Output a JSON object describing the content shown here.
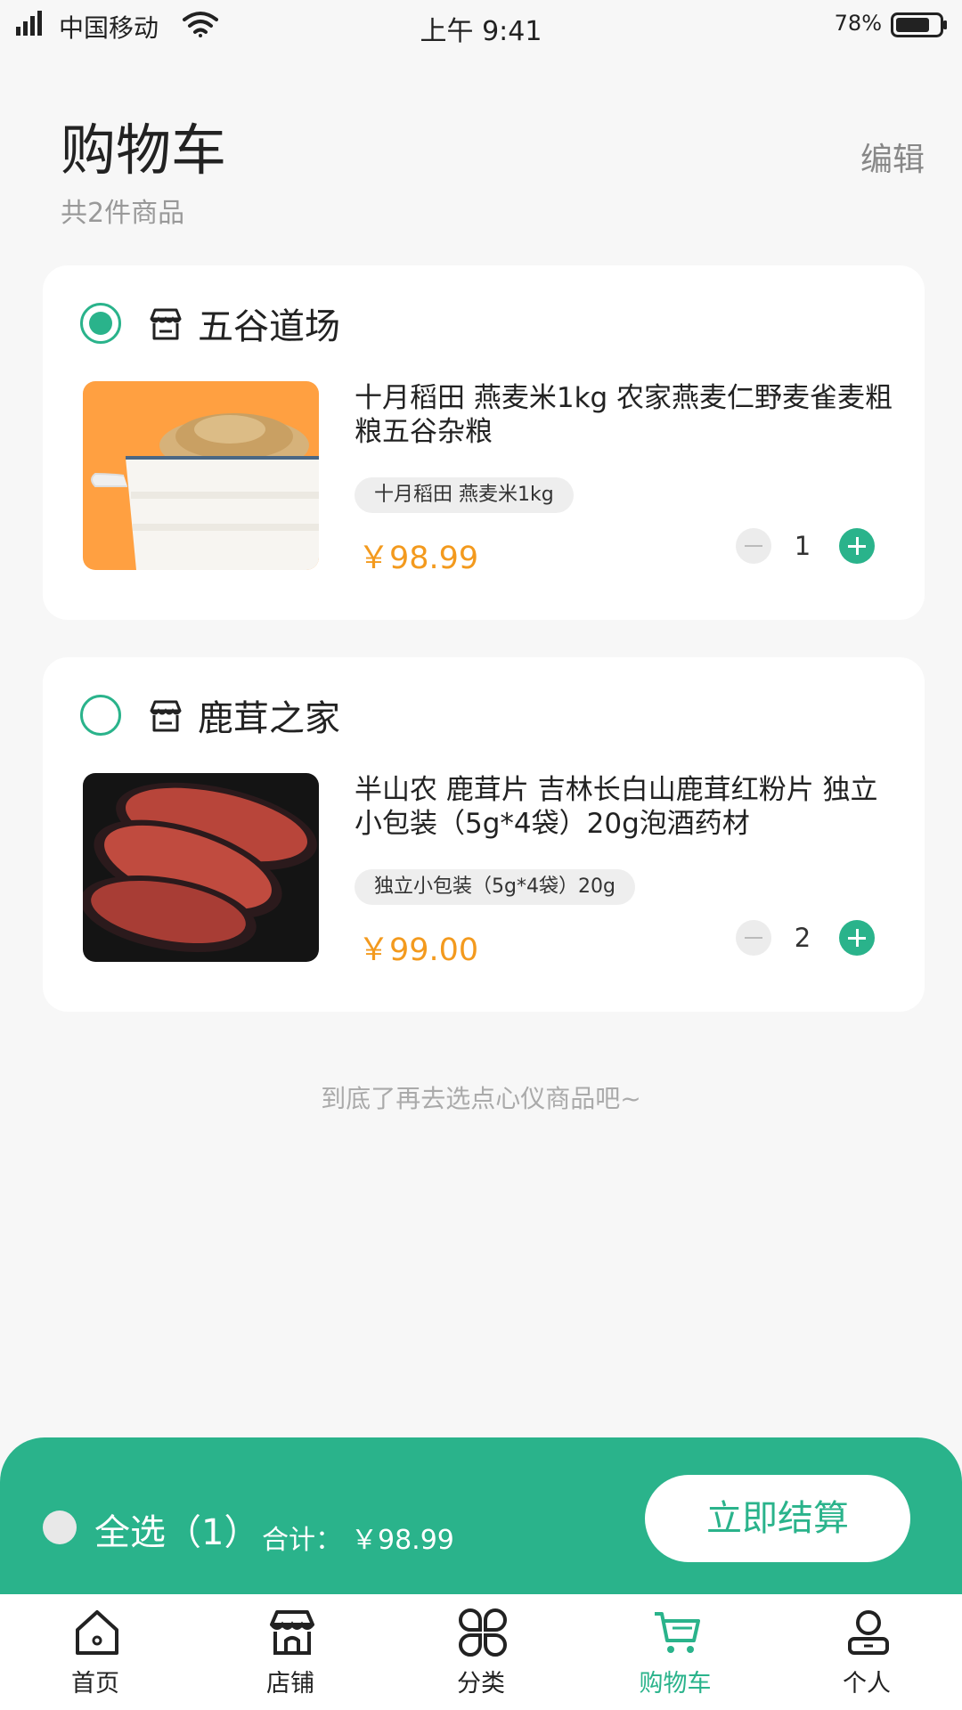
{
  "status_bar": {
    "carrier": "中国移动",
    "time": "上午 9:41",
    "battery": "78%",
    "battery_level": 0.78
  },
  "header": {
    "title": "购物车",
    "edit_label": "编辑",
    "item_count": "共2件商品"
  },
  "stores": [
    {
      "name": "五谷道场",
      "selected": true,
      "product": {
        "title": "十月稻田 燕麦米1kg 农家燕麦仁野麦雀麦粗粮五谷杂粮",
        "spec": "十月稻田 燕麦米1kg",
        "price": "￥98.99",
        "quantity": "1"
      }
    },
    {
      "name": "鹿茸之家",
      "selected": false,
      "product": {
        "title": "半山农 鹿茸片 吉林长白山鹿茸红粉片 独立小包装（5g*4袋）20g泡酒药材",
        "spec": "独立小包装（5g*4袋）20g",
        "price": "￥99.00",
        "quantity": "2"
      }
    }
  ],
  "end_note": "到底了再去选点心仪商品吧~",
  "checkout": {
    "select_all_label": "全选（1）",
    "total_label": "合计：",
    "total_amount": "￥98.99",
    "button_label": "立即结算"
  },
  "tabs": [
    {
      "label": "首页",
      "icon": "home-icon",
      "active": false
    },
    {
      "label": "店铺",
      "icon": "store-icon",
      "active": false
    },
    {
      "label": "分类",
      "icon": "category-icon",
      "active": false
    },
    {
      "label": "购物车",
      "icon": "cart-icon",
      "active": true
    },
    {
      "label": "个人",
      "icon": "user-icon",
      "active": false
    }
  ],
  "colors": {
    "accent": "#2ab38b",
    "price": "#f39a1e",
    "background": "#f7f7f7"
  }
}
